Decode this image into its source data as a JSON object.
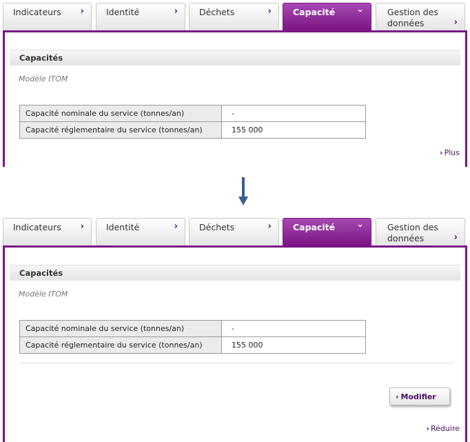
{
  "tabs": [
    {
      "label": "Indicateurs",
      "chevron": "›"
    },
    {
      "label": "Identité",
      "chevron": "›"
    },
    {
      "label": "Déchets",
      "chevron": "›"
    },
    {
      "label": "Capacité",
      "chevron": "⌄"
    },
    {
      "label": "Gestion des données",
      "chevron": "›"
    }
  ],
  "section": {
    "title": "Capacités",
    "subtitle": "Modèle ITOM"
  },
  "table": {
    "rows": [
      {
        "label": "Capacité nominale du service (tonnes/an)",
        "value": "-"
      },
      {
        "label": "Capacité réglementaire du service (tonnes/an)",
        "value": "155 000"
      }
    ]
  },
  "links": {
    "plus": "Plus",
    "reduire": "Réduire",
    "modifier": "Modifier"
  },
  "colors": {
    "accent": "#7a1585",
    "arrow": "#3b5f8f"
  },
  "icons": [
    "chevron-right-icon",
    "chevron-down-icon",
    "down-arrow-icon"
  ]
}
